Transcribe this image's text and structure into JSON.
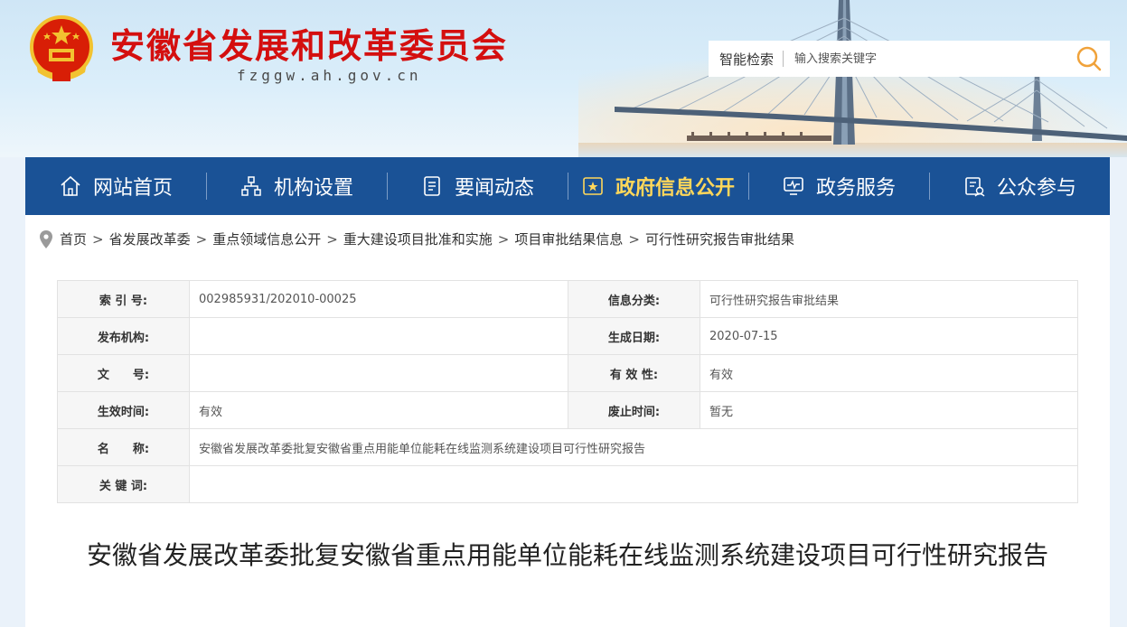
{
  "header": {
    "title": "安徽省发展和改革委员会",
    "domain": "fzggw.ah.gov.cn",
    "emblem_icon": "national-emblem-icon",
    "search": {
      "label": "智能检索",
      "placeholder": "输入搜索关键字",
      "button_icon": "search-icon"
    }
  },
  "nav": {
    "items": [
      {
        "label": "网站首页",
        "icon": "home-icon"
      },
      {
        "label": "机构设置",
        "icon": "org-chart-icon"
      },
      {
        "label": "要闻动态",
        "icon": "news-icon"
      },
      {
        "label": "政府信息公开",
        "icon": "info-board-icon",
        "active": true
      },
      {
        "label": "政务服务",
        "icon": "monitor-service-icon"
      },
      {
        "label": "公众参与",
        "icon": "participation-icon"
      }
    ]
  },
  "breadcrumb": [
    "首页",
    "省发展改革委",
    "重点领域信息公开",
    "重大建设项目批准和实施",
    "项目审批结果信息",
    "可行性研究报告审批结果"
  ],
  "meta": {
    "index_label": "索 引 号:",
    "index_value": "002985931/202010-00025",
    "category_label": "信息分类:",
    "category_value": "可行性研究报告审批结果",
    "publisher_label": "发布机构:",
    "publisher_value": "",
    "date_label": "生成日期:",
    "date_value": "2020-07-15",
    "docno_label": "文　　号:",
    "docno_value": "",
    "validity_label": "有 效 性:",
    "validity_value": "有效",
    "effective_label": "生效时间:",
    "effective_value": "有效",
    "expire_label": "废止时间:",
    "expire_value": "暂无",
    "name_label": "名　　称:",
    "name_value": "安徽省发展改革委批复安徽省重点用能单位能耗在线监测系统建设项目可行性研究报告",
    "keywords_label": "关 键 词:",
    "keywords_value": ""
  },
  "article": {
    "title": "安徽省发展改革委批复安徽省重点用能单位能耗在线监测系统建设项目可行性研究报告"
  },
  "colors": {
    "brand_red": "#d40f0f",
    "nav_blue": "#1a5296",
    "nav_active": "#ffd75a",
    "search_orange": "#f0a23a"
  }
}
